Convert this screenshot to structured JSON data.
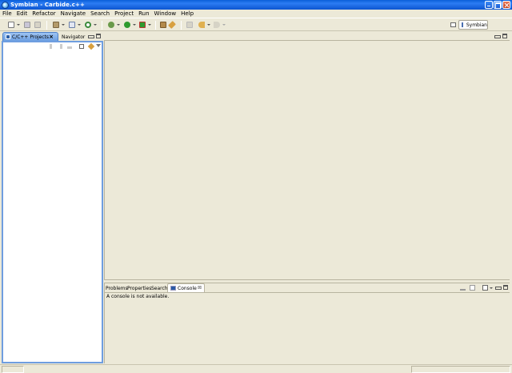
{
  "window": {
    "title": "Symbian - Carbide.c++"
  },
  "menu": {
    "items": [
      "File",
      "Edit",
      "Refactor",
      "Navigate",
      "Search",
      "Project",
      "Run",
      "Window",
      "Help"
    ]
  },
  "toolbar": {
    "perspective_label": "Symbian",
    "icons": [
      "new-icon",
      "save-icon",
      "print-icon",
      "build-icon",
      "new-class-icon",
      "search-icon",
      "debug-icon",
      "run-icon",
      "external-tools-icon",
      "open-type-icon",
      "pin-icon",
      "last-edit-icon",
      "back-icon",
      "forward-icon",
      "open-perspective-icon"
    ]
  },
  "left_view": {
    "active_tab": "C/C++ Projects",
    "other_tab": "Navigator"
  },
  "bottom_view": {
    "tabs": [
      "Problems",
      "Properties",
      "Search"
    ],
    "active_tab": "Console",
    "console_message": "A console is not available."
  },
  "colors": {
    "titlebar": "#0c55d0",
    "workbench": "#ece9d8",
    "active_tab": "#6d9fe2",
    "view_border": "#6f9ee0"
  }
}
